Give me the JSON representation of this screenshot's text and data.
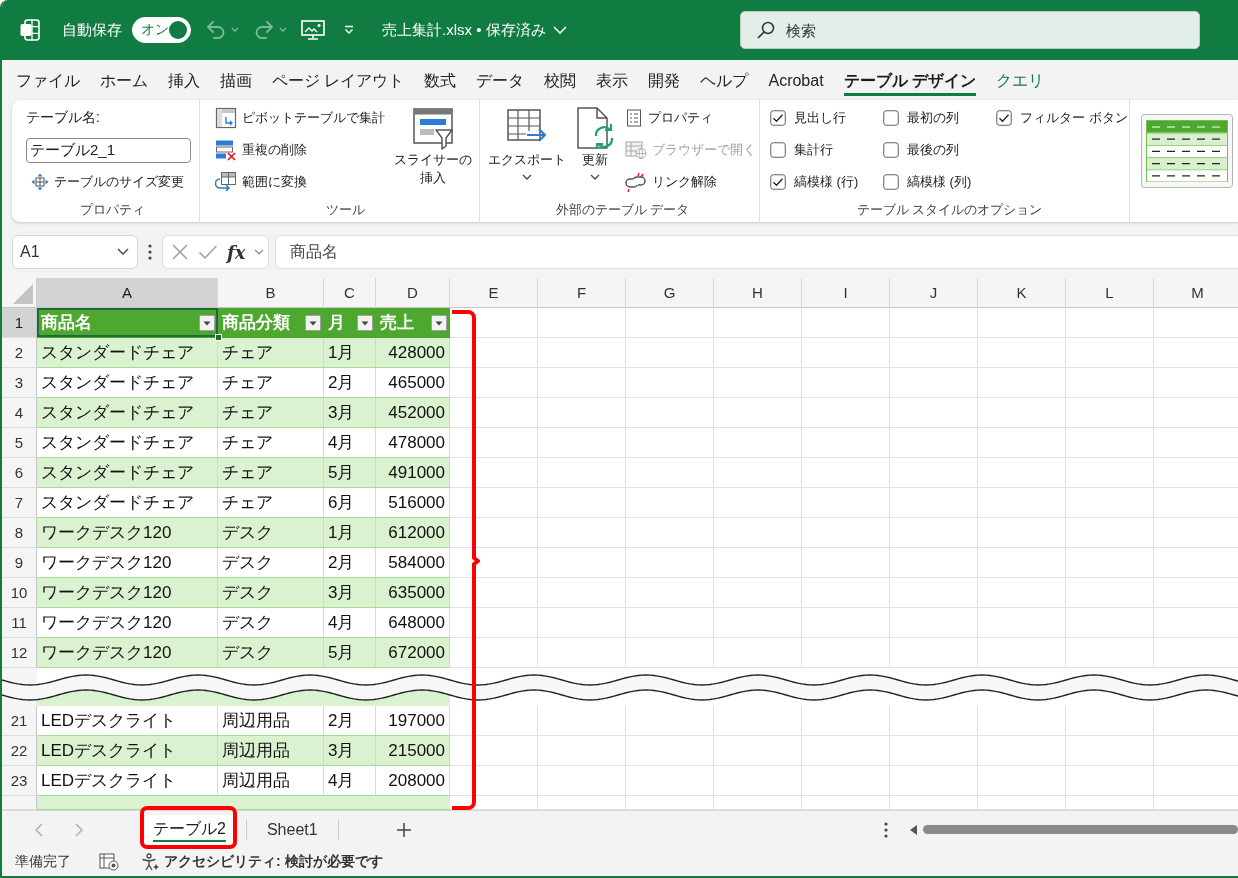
{
  "title_bar": {
    "autosave": {
      "label": "自動保存",
      "on": true,
      "state_label": "オン"
    },
    "document_title": "売上集計.xlsx • 保存済み",
    "search": {
      "placeholder": "検索"
    }
  },
  "menu_tabs": [
    {
      "label": "ファイル",
      "selected": false,
      "contextual": false
    },
    {
      "label": "ホーム",
      "selected": false,
      "contextual": false
    },
    {
      "label": "挿入",
      "selected": false,
      "contextual": false
    },
    {
      "label": "描画",
      "selected": false,
      "contextual": false
    },
    {
      "label": "ページ レイアウト",
      "selected": false,
      "contextual": false
    },
    {
      "label": "数式",
      "selected": false,
      "contextual": false
    },
    {
      "label": "データ",
      "selected": false,
      "contextual": false
    },
    {
      "label": "校閲",
      "selected": false,
      "contextual": false
    },
    {
      "label": "表示",
      "selected": false,
      "contextual": false
    },
    {
      "label": "開発",
      "selected": false,
      "contextual": false
    },
    {
      "label": "ヘルプ",
      "selected": false,
      "contextual": false
    },
    {
      "label": "Acrobat",
      "selected": false,
      "contextual": false
    },
    {
      "label": "テーブル デザイン",
      "selected": true,
      "contextual": true
    },
    {
      "label": "クエリ",
      "selected": false,
      "contextual": true
    }
  ],
  "ribbon": {
    "properties": {
      "title": "プロパティ",
      "table_name_label": "テーブル名:",
      "table_name": "テーブル2_1",
      "resize_button": "テーブルのサイズ変更"
    },
    "tools": {
      "title": "ツール",
      "buttons": [
        "ピボットテーブルで集計",
        "重複の削除",
        "範囲に変換"
      ],
      "large_button": "スライサーの挿入"
    },
    "external_data": {
      "title": "外部のテーブル データ",
      "large_buttons": [
        {
          "label": "エクスポート",
          "menu": true
        },
        {
          "label": "更新",
          "menu": true
        }
      ],
      "buttons": [
        {
          "label": "プロパティ",
          "disabled": false
        },
        {
          "label": "ブラウザーで開く",
          "disabled": true
        },
        {
          "label": "リンク解除",
          "disabled": false
        }
      ]
    },
    "style_options": {
      "title": "テーブル スタイルのオプション",
      "checkboxes": [
        {
          "label": "見出し行",
          "checked": true
        },
        {
          "label": "集計行",
          "checked": false
        },
        {
          "label": "縞模様 (行)",
          "checked": true
        },
        {
          "label": "最初の列",
          "checked": false
        },
        {
          "label": "最後の列",
          "checked": false
        },
        {
          "label": "縞模様 (列)",
          "checked": false
        },
        {
          "label": "フィルター ボタン",
          "checked": true
        }
      ]
    }
  },
  "formula_bar": {
    "name_box": "A1",
    "function_label": "fx",
    "formula": "商品名"
  },
  "sheet": {
    "columns": [
      {
        "label": "A",
        "selected": true
      },
      {
        "label": "B",
        "selected": false
      },
      {
        "label": "C",
        "selected": false
      },
      {
        "label": "D",
        "selected": false
      },
      {
        "label": "E",
        "selected": false
      },
      {
        "label": "F",
        "selected": false
      },
      {
        "label": "G",
        "selected": false
      },
      {
        "label": "H",
        "selected": false
      },
      {
        "label": "I",
        "selected": false
      },
      {
        "label": "J",
        "selected": false
      },
      {
        "label": "K",
        "selected": false
      },
      {
        "label": "L",
        "selected": false
      },
      {
        "label": "M",
        "selected": false
      }
    ],
    "header_row": {
      "number": "1",
      "selected": true,
      "cells": [
        "商品名",
        "商品分類",
        "月",
        "売上"
      ]
    },
    "segments": [
      {
        "rows": [
          {
            "number": "2",
            "selected": false,
            "banded": true,
            "cells": [
              "スタンダードチェア",
              "チェア",
              "1月",
              "428000"
            ]
          },
          {
            "number": "3",
            "selected": false,
            "banded": false,
            "cells": [
              "スタンダードチェア",
              "チェア",
              "2月",
              "465000"
            ]
          },
          {
            "number": "4",
            "selected": false,
            "banded": true,
            "cells": [
              "スタンダードチェア",
              "チェア",
              "3月",
              "452000"
            ]
          },
          {
            "number": "5",
            "selected": false,
            "banded": false,
            "cells": [
              "スタンダードチェア",
              "チェア",
              "4月",
              "478000"
            ]
          },
          {
            "number": "6",
            "selected": false,
            "banded": true,
            "cells": [
              "スタンダードチェア",
              "チェア",
              "5月",
              "491000"
            ]
          },
          {
            "number": "7",
            "selected": false,
            "banded": false,
            "cells": [
              "スタンダードチェア",
              "チェア",
              "6月",
              "516000"
            ]
          },
          {
            "number": "8",
            "selected": false,
            "banded": true,
            "cells": [
              "ワークデスク120",
              "デスク",
              "1月",
              "612000"
            ]
          },
          {
            "number": "9",
            "selected": false,
            "banded": false,
            "cells": [
              "ワークデスク120",
              "デスク",
              "2月",
              "584000"
            ]
          },
          {
            "number": "10",
            "selected": false,
            "banded": true,
            "cells": [
              "ワークデスク120",
              "デスク",
              "3月",
              "635000"
            ]
          },
          {
            "number": "11",
            "selected": false,
            "banded": false,
            "cells": [
              "ワークデスク120",
              "デスク",
              "4月",
              "648000"
            ]
          },
          {
            "number": "12",
            "selected": false,
            "banded": true,
            "cells": [
              "ワークデスク120",
              "デスク",
              "5月",
              "672000"
            ]
          }
        ]
      },
      {
        "rows": [
          {
            "number": "21",
            "selected": false,
            "banded": false,
            "cells": [
              "LEDデスクライト",
              "周辺用品",
              "2月",
              "197000"
            ]
          },
          {
            "number": "22",
            "selected": false,
            "banded": true,
            "cells": [
              "LEDデスクライト",
              "周辺用品",
              "3月",
              "215000"
            ]
          },
          {
            "number": "23",
            "selected": false,
            "banded": false,
            "cells": [
              "LEDデスクライト",
              "周辺用品",
              "4月",
              "208000"
            ]
          }
        ]
      }
    ]
  },
  "sheet_tabs": [
    {
      "label": "テーブル2",
      "selected": true
    },
    {
      "label": "Sheet1",
      "selected": false
    }
  ],
  "status_bar": {
    "mode": "準備完了",
    "accessibility": "アクセシビリティ: 検討が必要です"
  }
}
